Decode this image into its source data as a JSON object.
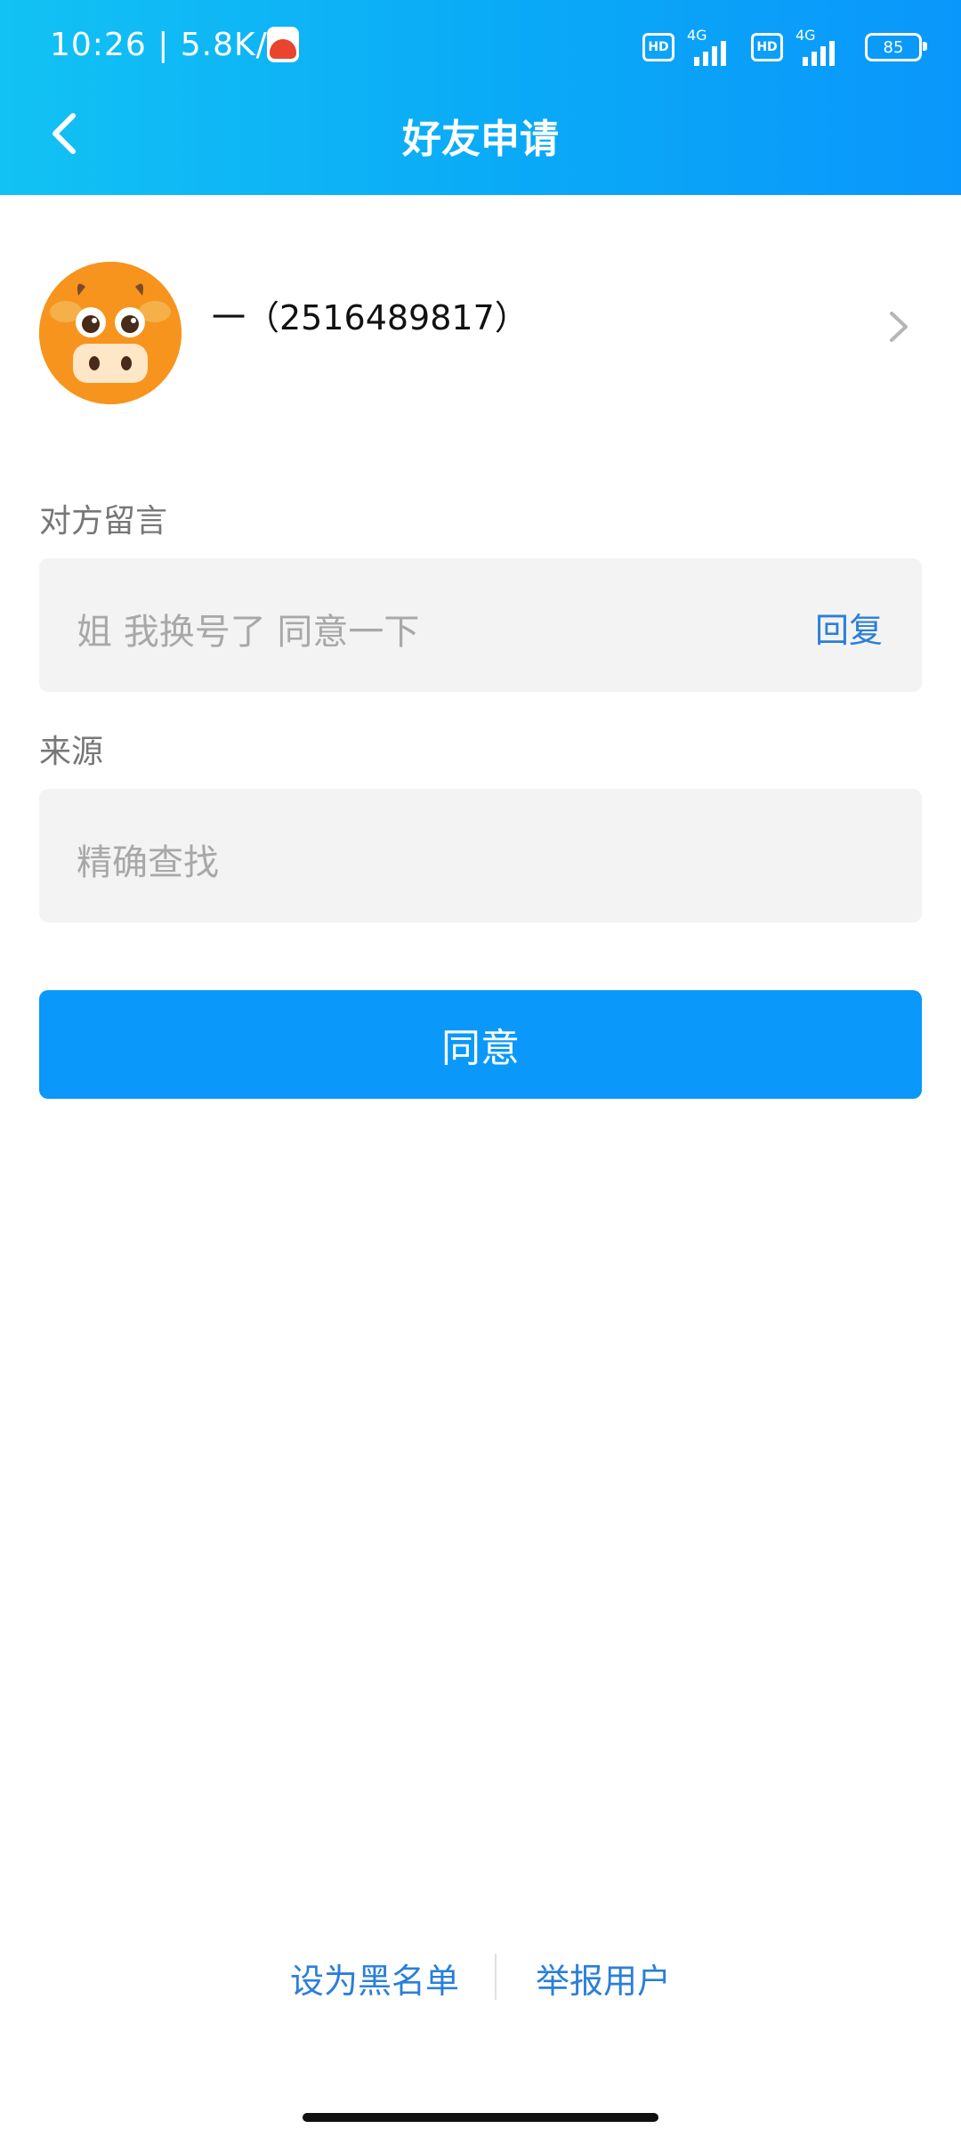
{
  "status_bar": {
    "time_speed": "10:26 | 5.8K/s",
    "network1": "4G",
    "network2": "4G",
    "hd1": "HD",
    "hd2": "HD",
    "battery": "85"
  },
  "header": {
    "title": "好友申请",
    "back_icon": "chevron-left-icon"
  },
  "profile": {
    "name": "一（2516489817）",
    "avatar_icon": "cow-avatar",
    "chevron_icon": "chevron-right-icon"
  },
  "message_section": {
    "label": "对方留言",
    "text": "姐  我换号了 同意一下",
    "reply_label": "回复"
  },
  "source_section": {
    "label": "来源",
    "text": "精确查找"
  },
  "actions": {
    "agree_label": "同意",
    "blacklist_label": "设为黑名单",
    "report_label": "举报用户"
  },
  "colors": {
    "primary": "#0a98fb",
    "link": "#2a7fd8",
    "avatar_bg": "#f7941d"
  }
}
